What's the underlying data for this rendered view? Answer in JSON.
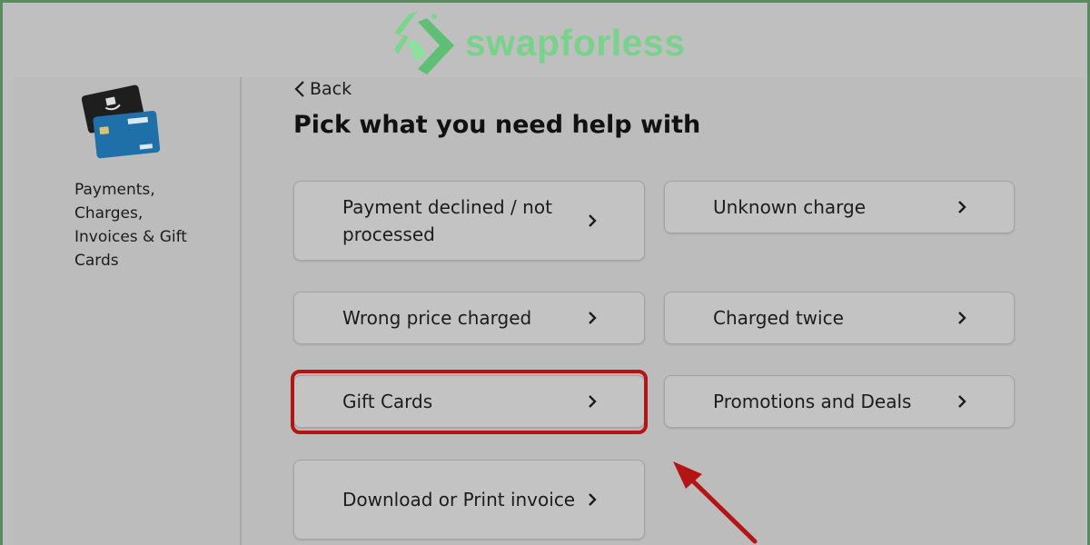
{
  "brand": {
    "name": "swapforless",
    "color": "#79d28c",
    "icon": "swapforless-logo-icon"
  },
  "sidebar": {
    "image_icon": "payment-cards-icon",
    "label_lines": [
      "Payments,",
      "Charges,",
      "Invoices & Gift",
      "Cards"
    ]
  },
  "main": {
    "back_label": "Back",
    "title": "Pick what you need help with",
    "options": [
      {
        "label": "Payment declined / not processed"
      },
      {
        "label": "Unknown charge"
      },
      {
        "label": "Wrong price charged"
      },
      {
        "label": "Charged twice"
      },
      {
        "label": "Gift Cards",
        "highlighted": true
      },
      {
        "label": "Promotions and Deals"
      },
      {
        "label": "Download or Print invoice"
      }
    ]
  },
  "colors": {
    "highlight": "#b51414",
    "background": "#bfbfbf",
    "frame_border": "#5a8a5f"
  }
}
